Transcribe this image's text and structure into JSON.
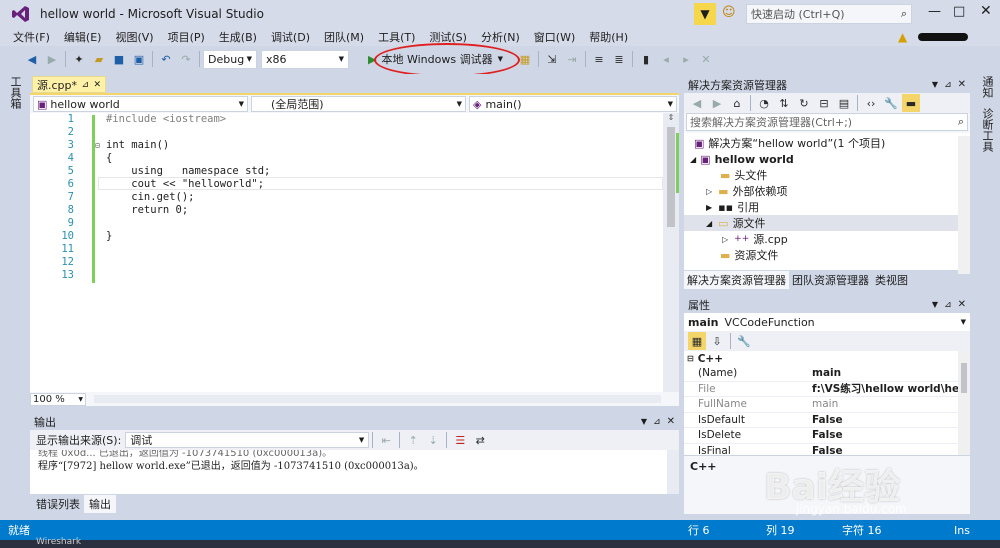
{
  "window": {
    "title": "hellow world - Microsoft Visual Studio",
    "quick_launch_placeholder": "快速启动 (Ctrl+Q)"
  },
  "menu": [
    "文件(F)",
    "编辑(E)",
    "视图(V)",
    "项目(P)",
    "生成(B)",
    "调试(D)",
    "团队(M)",
    "工具(T)",
    "测试(S)",
    "分析(N)",
    "窗口(W)",
    "帮助(H)"
  ],
  "toolbar": {
    "config": "Debug",
    "platform": "x86",
    "run_label": "本地 Windows 调试器"
  },
  "left_strip": {
    "toolbox_label": "工具箱"
  },
  "editor": {
    "tab_label": "源.cpp*",
    "nav_project": "hellow world",
    "nav_scope": "(全局范围)",
    "nav_function": "main()",
    "zoom": "100 %",
    "lines": [
      {
        "n": "1",
        "code": "#include <iostream>"
      },
      {
        "n": "2",
        "code": ""
      },
      {
        "n": "3",
        "code": "int main()"
      },
      {
        "n": "4",
        "code": "{"
      },
      {
        "n": "5",
        "code": "    using   namespace std;"
      },
      {
        "n": "6",
        "code": "    cout << \"helloworld\";"
      },
      {
        "n": "7",
        "code": "    cin.get();"
      },
      {
        "n": "8",
        "code": "    return 0;"
      },
      {
        "n": "9",
        "code": ""
      },
      {
        "n": "10",
        "code": "}"
      },
      {
        "n": "11",
        "code": ""
      },
      {
        "n": "12",
        "code": ""
      },
      {
        "n": "13",
        "code": ""
      }
    ]
  },
  "output": {
    "title": "输出",
    "source_label": "显示输出来源(S):",
    "source_value": "调试",
    "partial_line": "线程 0x0d... 已退出，返回值为 -1073741510 (0xc000013a)。",
    "last_line": "程序“[7972] hellow world.exe”已退出，返回值为 -1073741510 (0xc000013a)。",
    "tabs": [
      "错误列表",
      "输出"
    ]
  },
  "solution_explorer": {
    "title": "解决方案资源管理器",
    "search_placeholder": "搜索解决方案资源管理器(Ctrl+;)",
    "tree": [
      {
        "label": "解决方案“hellow world”(1 个项目)",
        "indent": 0,
        "bold": false
      },
      {
        "label": "hellow world",
        "indent": 1,
        "bold": true
      },
      {
        "label": "头文件",
        "indent": 2,
        "bold": false
      },
      {
        "label": "外部依赖项",
        "indent": 2,
        "bold": false
      },
      {
        "label": "引用",
        "indent": 2,
        "bold": false
      },
      {
        "label": "源文件",
        "indent": 2,
        "bold": false
      },
      {
        "label": "源.cpp",
        "indent": 3,
        "bold": false
      },
      {
        "label": "资源文件",
        "indent": 2,
        "bold": false
      }
    ],
    "tabs": [
      "解决方案资源管理器",
      "团队资源管理器",
      "类视图"
    ]
  },
  "properties": {
    "title": "属性",
    "object_name": "main",
    "object_type": "VCCodeFunction",
    "category": "C++",
    "rows": [
      {
        "k": "(Name)",
        "v": "main"
      },
      {
        "k": "File",
        "v": "f:\\VS练习\\hellow world\\he"
      },
      {
        "k": "FullName",
        "v": "main"
      },
      {
        "k": "IsDefault",
        "v": "False"
      },
      {
        "k": "IsDelete",
        "v": "False"
      },
      {
        "k": "IsFinal",
        "v": "False"
      }
    ],
    "description": "C++"
  },
  "right_strip": {
    "label1": "通知",
    "label2": "诊断工具"
  },
  "statusbar": {
    "ready": "就绪",
    "row": "行 6",
    "col": "列 19",
    "char": "字符 16",
    "mode": "Ins"
  },
  "taskbar": {
    "item": "Wireshark"
  },
  "watermark": {
    "brand": "Bai经验",
    "url": "jingyan.baidu.com"
  },
  "colors": {
    "accent": "#007acc",
    "vs_purple": "#68217a",
    "annotation_red": "#e02020"
  }
}
